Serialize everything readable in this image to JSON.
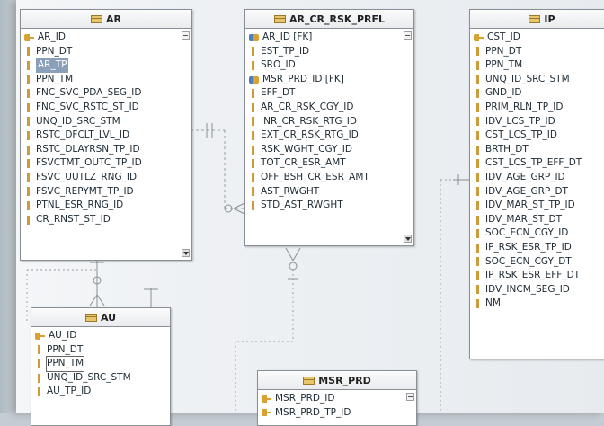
{
  "entities": {
    "ar": {
      "title": "AR",
      "columns": [
        "AR_ID",
        "PPN_DT",
        "AR_TP",
        "PPN_TM",
        "FNC_SVC_PDA_SEG_ID",
        "FNC_SVC_RSTC_ST_ID",
        "UNQ_ID_SRC_STM",
        "RSTC_DFCLT_LVL_ID",
        "RSTC_DLAYRSN_TP_ID",
        "FSVCTMT_OUTC_TP_ID",
        "FSVC_UUTLZ_RNG_ID",
        "FSVC_REPYMT_TP_ID",
        "PTNL_ESR_RNG_ID",
        "CR_RNST_ST_ID"
      ]
    },
    "ar_cr_rsk_prfl": {
      "title": "AR_CR_RSK_PRFL",
      "columns": [
        "AR_ID [FK]",
        "EST_TP_ID",
        "SRO_ID",
        "MSR_PRD_ID [FK]",
        "EFF_DT",
        "AR_CR_RSK_CGY_ID",
        "INR_CR_RSK_RTG_ID",
        "EXT_CR_RSK_RTG_ID",
        "RSK_WGHT_CGY_ID",
        "TOT_CR_ESR_AMT",
        "OFF_BSH_CR_ESR_AMT",
        "AST_RWGHT",
        "STD_AST_RWGHT"
      ]
    },
    "ip": {
      "title": "IP",
      "columns": [
        "CST_ID",
        "PPN_DT",
        "PPN_TM",
        "UNQ_ID_SRC_STM",
        "GND_ID",
        "PRIM_RLN_TP_ID",
        "IDV_LCS_TP_ID",
        "CST_LCS_TP_ID",
        "BRTH_DT",
        "CST_LCS_TP_EFF_DT",
        "IDV_AGE_GRP_ID",
        "IDV_AGE_GRP_DT",
        "IDV_MAR_ST_TP_ID",
        "IDV_MAR_ST_DT",
        "SOC_ECN_CGY_ID",
        "IP_RSK_ESR_TP_ID",
        "SOC_ECN_CGY_DT",
        "IP_RSK_ESR_EFF_DT",
        "IDV_INCM_SEG_ID",
        "NM"
      ]
    },
    "au": {
      "title": "AU",
      "columns": [
        "AU_ID",
        "PPN_DT",
        "PPN_TM",
        "UNQ_ID_SRC_STM",
        "AU_TP_ID"
      ]
    },
    "msr_prd": {
      "title": "MSR_PRD",
      "columns": [
        "MSR_PRD_ID",
        "MSR_PRD_TP_ID"
      ]
    }
  },
  "icons": {
    "table": "table-icon",
    "key": "key-icon",
    "foreign_key": "foreign-key-icon",
    "column": "column-icon"
  }
}
